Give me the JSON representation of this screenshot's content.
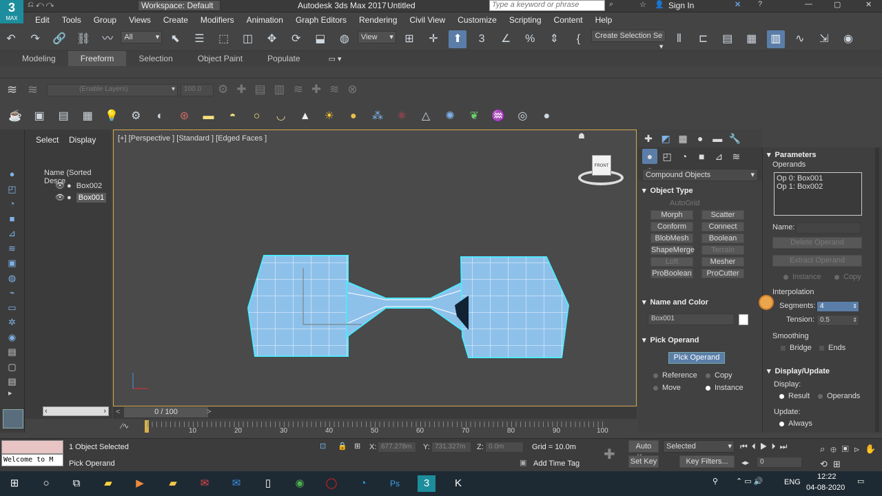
{
  "titlebar": {
    "workspace": "Workspace: Default",
    "title": "Autodesk 3ds Max 2017",
    "doc": "Untitled",
    "search_placeholder": "Type a keyword or phrase",
    "signin": "Sign In"
  },
  "logo": {
    "line1": "3",
    "line2": "MAX"
  },
  "menus": [
    "Edit",
    "Tools",
    "Group",
    "Views",
    "Create",
    "Modifiers",
    "Animation",
    "Graph Editors",
    "Rendering",
    "Civil View",
    "Customize",
    "Scripting",
    "Content",
    "Help"
  ],
  "toolbar": {
    "filter": "All",
    "refcoord": "View",
    "selset": "Create Selection Se"
  },
  "ribbon": {
    "tabs": [
      "Modeling",
      "Freeform",
      "Selection",
      "Object Paint",
      "Populate"
    ],
    "active": "Freeform"
  },
  "layers": {
    "name": "(Enable Layers)",
    "value": "100.0"
  },
  "scene": {
    "tabs": [
      "Select",
      "Display"
    ],
    "header": "Name (Sorted Desce",
    "items": [
      "Box002",
      "Box001"
    ],
    "selected": "Box001"
  },
  "viewport": {
    "label": "[+] [Perspective ] [Standard ] [Edged Faces ]",
    "cube_text": "FRONT"
  },
  "cmd": {
    "dropdown": "Compound Objects",
    "object_type": {
      "title": "Object Type",
      "autogrid": "AutoGrid",
      "buttons": [
        "Morph",
        "Scatter",
        "Conform",
        "Connect",
        "BlobMesh",
        "Boolean",
        "ShapeMerge",
        "Terrain",
        "Loft",
        "Mesher",
        "ProBoolean",
        "ProCutter"
      ]
    },
    "name_color": {
      "title": "Name and Color",
      "name": "Box001",
      "color": "#ffffff"
    },
    "pick": {
      "title": "Pick Operand",
      "button": "Pick Operand",
      "options": [
        "Reference",
        "Copy",
        "Move",
        "Instance"
      ],
      "selected": "Instance"
    }
  },
  "params": {
    "title": "Parameters",
    "operands_label": "Operands",
    "operands": [
      "Op 0: Box001",
      "Op 1: Box002"
    ],
    "name_label": "Name:",
    "delete": "Delete Operand",
    "extract": "Extract Operand",
    "instance": "Instance",
    "copy": "Copy",
    "interp": "Interpolation",
    "segments_label": "Segments:",
    "segments": "4",
    "tension_label": "Tension:",
    "tension": "0.5",
    "smoothing": "Smoothing",
    "bridge": "Bridge",
    "ends": "Ends",
    "display_update": "Display/Update",
    "display": "Display:",
    "result": "Result",
    "operands_opt": "Operands",
    "update": "Update:",
    "always": "Always"
  },
  "timeline": {
    "frame": "0 / 100",
    "ticks": [
      "10",
      "20",
      "30",
      "40",
      "50",
      "60",
      "70",
      "80",
      "90",
      "100"
    ]
  },
  "status": {
    "listener": "Welcome to M",
    "selected": "1 Object Selected",
    "prompt": "Pick Operand",
    "x_label": "X:",
    "x": "677.278m",
    "y_label": "Y:",
    "y": "731.327m",
    "z_label": "Z:",
    "z": "0.0m",
    "grid": "Grid = 10.0m",
    "add_time_tag": "Add Time Tag",
    "autokey": "Auto Key",
    "setkey": "Set Key",
    "selected_mode": "Selected",
    "keyfilters": "Key Filters...",
    "frame_field": "0"
  },
  "taskbar": {
    "time": "12:22",
    "date": "04-08-2020",
    "lang": "ENG"
  }
}
